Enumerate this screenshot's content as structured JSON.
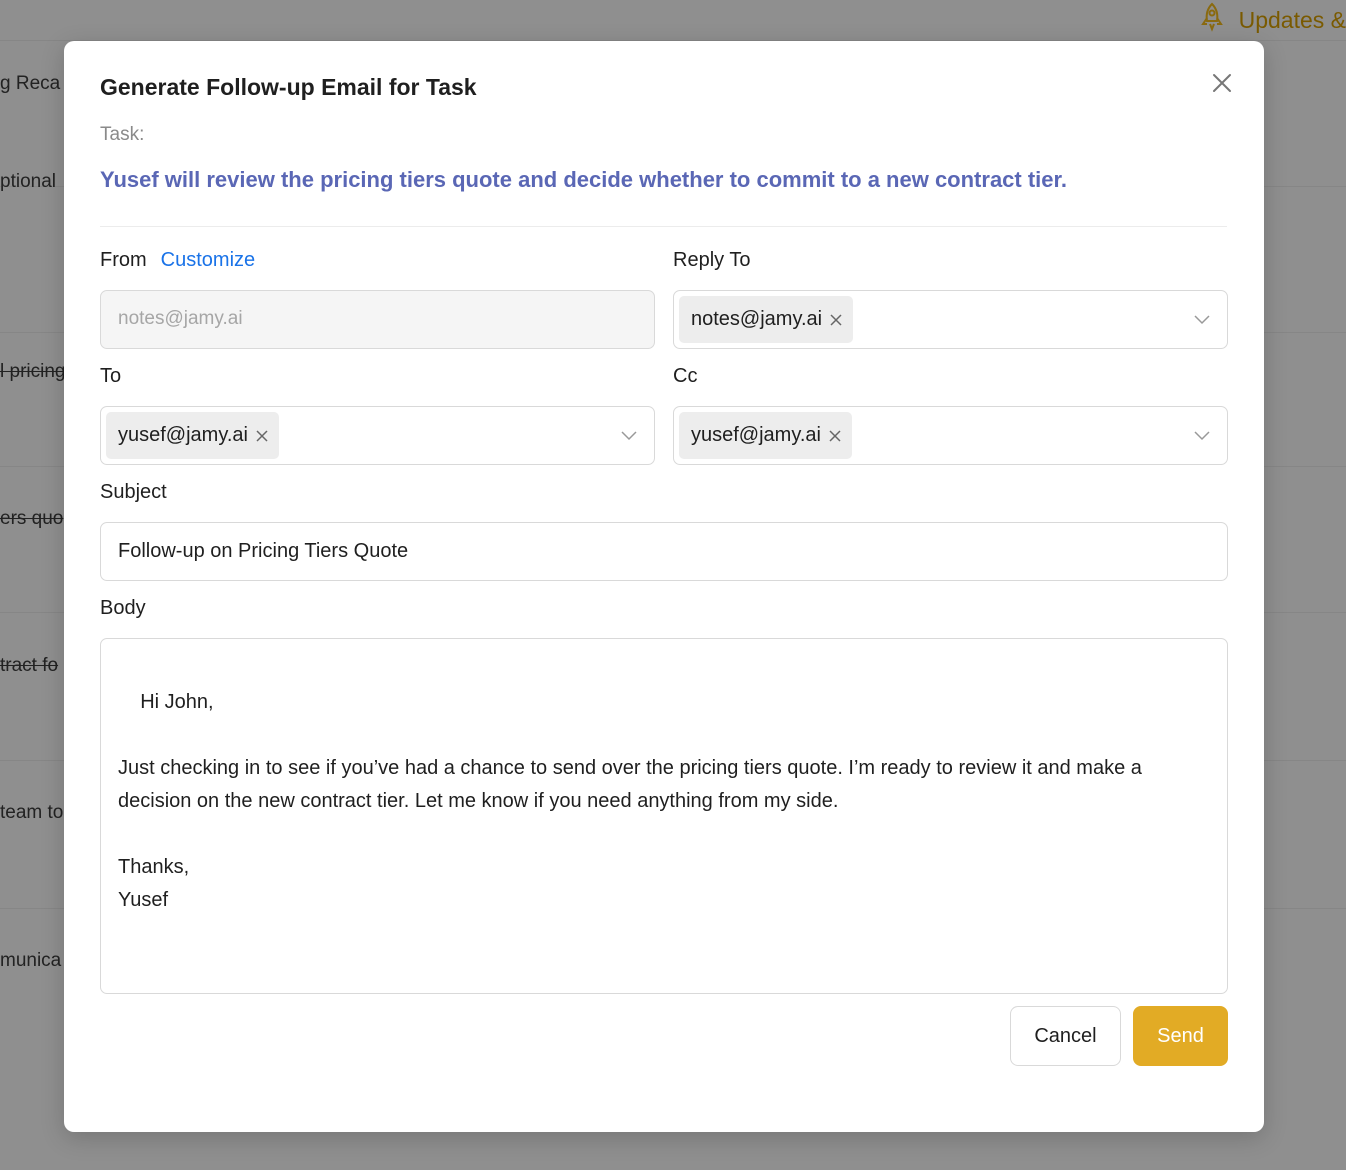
{
  "background": {
    "updates_label": "Updates &",
    "rows": [
      {
        "text": "g Reca",
        "strike": false
      },
      {
        "text": "ptional",
        "strike": false
      },
      {
        "text": "l pricing",
        "strike": true
      },
      {
        "text": "ers quo",
        "strike": true
      },
      {
        "text": "tract fo",
        "strike": true
      },
      {
        "text": "team to",
        "strike": false
      },
      {
        "text": "munica",
        "strike": false
      }
    ]
  },
  "modal": {
    "title": "Generate Follow-up Email for Task",
    "task_label": "Task:",
    "task_text": "Yusef will review the pricing tiers quote and decide whether to commit to a new contract tier.",
    "from": {
      "label": "From",
      "customize_label": "Customize",
      "placeholder": "notes@jamy.ai"
    },
    "reply_to": {
      "label": "Reply To",
      "tag": "notes@jamy.ai"
    },
    "to": {
      "label": "To",
      "tag": "yusef@jamy.ai"
    },
    "cc": {
      "label": "Cc",
      "tag": "yusef@jamy.ai"
    },
    "subject": {
      "label": "Subject",
      "value": "Follow-up on Pricing Tiers Quote"
    },
    "body": {
      "label": "Body",
      "value": "Hi John,\n\nJust checking in to see if you’ve had a chance to send over the pricing tiers quote. I’m ready to review it and make a\ndecision on the new contract tier. Let me know if you need anything from my side.\n\nThanks,\nYusef"
    },
    "buttons": {
      "cancel": "Cancel",
      "send": "Send"
    }
  },
  "colors": {
    "accent": "#e2ab25",
    "link": "#1a73e8",
    "task_text": "#5a67b5"
  }
}
